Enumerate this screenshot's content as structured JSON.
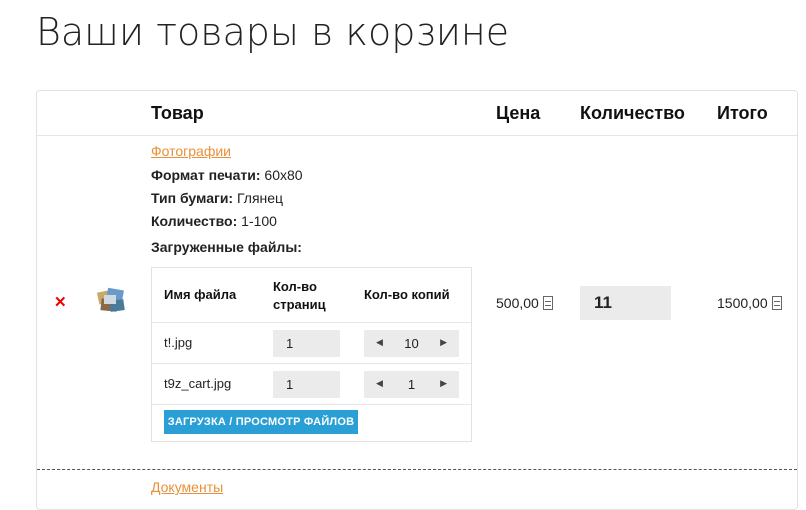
{
  "page": {
    "title": "Ваши товары в корзине"
  },
  "table": {
    "headers": {
      "product": "Товар",
      "price": "Цена",
      "quantity": "Количество",
      "total": "Итого"
    }
  },
  "item": {
    "remove_icon": "✕",
    "thumbnail_icon": "photos-thumbnail-icon",
    "category_link": "Фотографии",
    "meta": [
      {
        "label": "Формат печати:",
        "value": "60x80"
      },
      {
        "label": "Тип бумаги:",
        "value": "Глянец"
      },
      {
        "label": "Количество:",
        "value": "1-100"
      }
    ],
    "files_label": "Загруженные файлы:",
    "files_table": {
      "headers": {
        "name": "Имя файла",
        "pages": "Кол-во страниц",
        "copies": "Кол-во копий"
      },
      "rows": [
        {
          "name": "t!.jpg",
          "pages": "1",
          "copies": "10"
        },
        {
          "name": "t9z_cart.jpg",
          "pages": "1",
          "copies": "1"
        }
      ]
    },
    "upload_button": "ЗАГРУЗКА / ПРОСМОТР ФАЙЛОВ",
    "price": "500,00",
    "quantity": "11",
    "total": "1500,00"
  },
  "next_item": {
    "category_link": "Документы"
  },
  "colors": {
    "link": "#e8913a",
    "button": "#2a9fd6",
    "remove": "#e00000",
    "input_bg": "#ebebeb"
  }
}
